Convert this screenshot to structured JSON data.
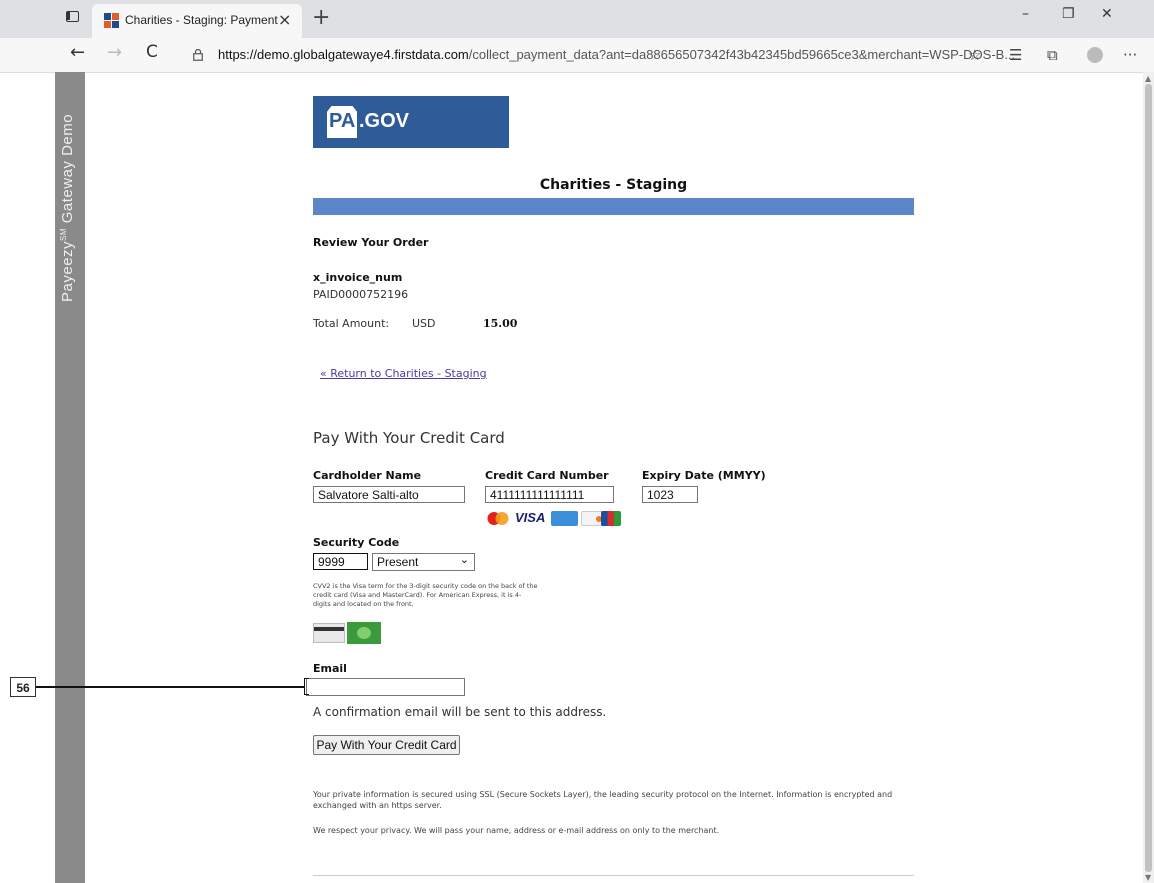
{
  "browser": {
    "tab_title": "Charities - Staging: Payment",
    "new_tab_symbol": "+",
    "close_tab_symbol": "×",
    "url_host": "https://demo.globalgatewaye4.firstdata.com",
    "url_path": "/collect_payment_data?ant=da88656507342f43b42345bd59665ce3&merchant=WSP-DOS-B...",
    "window_buttons": {
      "minimize": "–",
      "restore": "❐",
      "close": "✕"
    },
    "nav": {
      "back": "←",
      "forward": "→",
      "refresh": "C"
    },
    "toolbar_icons": [
      "favorites-add-icon",
      "favorites-icon",
      "collections-icon",
      "profile-icon",
      "more-icon"
    ],
    "more_label": "···"
  },
  "sidebar": {
    "banner_text_a": "Payeezy",
    "banner_sup": "SM",
    "banner_text_b": " Gateway Demo"
  },
  "logo": {
    "pa": "PA",
    "gov": ".GOV"
  },
  "merchant_title": "Charities - Staging",
  "review": {
    "heading": "Review Your Order",
    "invoice_label": "x_invoice_num",
    "invoice_value": "PAID0000752196",
    "total_label": "Total Amount:",
    "currency": "USD",
    "amount": "15.00",
    "return_link": "« Return to Charities - Staging"
  },
  "payment": {
    "heading": "Pay With Your Credit Card",
    "cardholder_label": "Cardholder Name",
    "cardholder_value": "Salvatore Salti-alto",
    "card_number_label": "Credit Card Number",
    "card_number_value": "4111111111111111",
    "expiry_label": "Expiry Date (MMYY)",
    "expiry_value": "1023",
    "card_brands": [
      "mastercard",
      "visa",
      "amex",
      "discover",
      "jcb"
    ],
    "visa_text": "VISA",
    "security_label": "Security Code",
    "security_value": "9999",
    "security_option": "Present",
    "cvv_note": "CVV2 is the Visa term for the 3-digit security code on the back of the credit card (Visa and MasterCard). For American Express, it is 4-digits and located on the front.",
    "email_label": "Email",
    "email_value": "",
    "email_hint": "A confirmation email will be sent to this address.",
    "submit_label": "Pay With Your Credit Card"
  },
  "footer": {
    "ssl_note": "Your private information is secured using SSL (Secure Sockets Layer), the leading security protocol on the Internet. Information is encrypted and exchanged with an https server.",
    "privacy_note": "We respect your privacy. We will pass your name, address or e-mail address on only to the merchant."
  },
  "annotation": {
    "label": "56"
  },
  "colors": {
    "logo_bg": "#2f5b99",
    "band": "#5b87c8",
    "link": "#4b3c9e",
    "sidebar": "#8a8a8a"
  }
}
